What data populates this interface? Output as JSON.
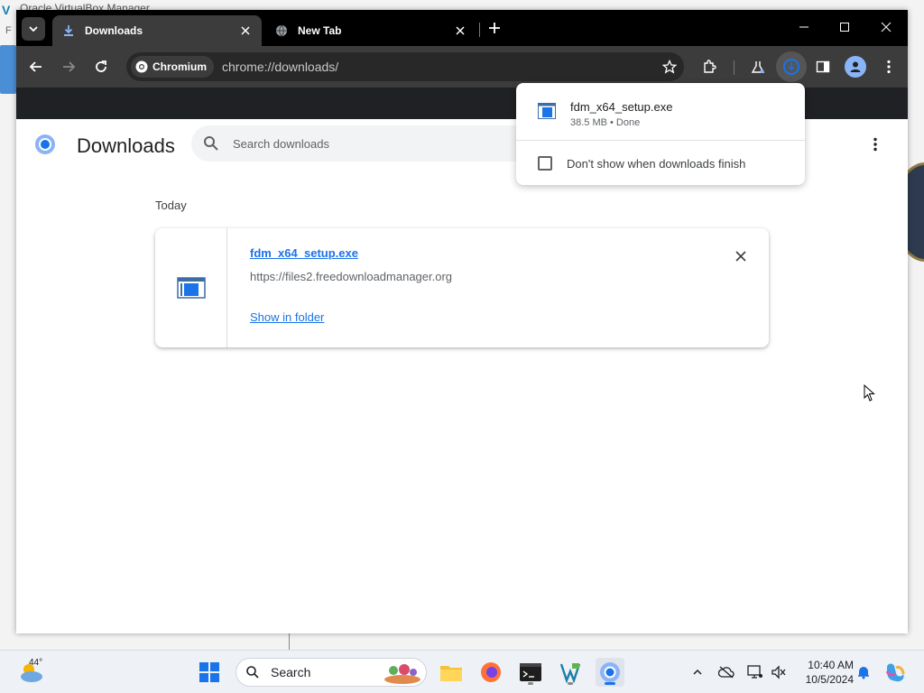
{
  "desktop": {
    "bg_app_title": "Oracle VirtualBox Manager",
    "bg_letter": "F"
  },
  "browser": {
    "tabs": [
      {
        "label": "Downloads",
        "active": true
      },
      {
        "label": "New Tab",
        "active": false
      }
    ],
    "toolbar": {
      "chip_label": "Chromium",
      "url": "chrome://downloads/"
    }
  },
  "downloads_page": {
    "title": "Downloads",
    "search_placeholder": "Search downloads",
    "section_label": "Today",
    "items": [
      {
        "file_name": "fdm_x64_setup.exe",
        "source_url": "https://files2.freedownloadmanager.org",
        "action_link": "Show in folder"
      }
    ]
  },
  "download_bubble": {
    "file_name": "fdm_x64_setup.exe",
    "status": "38.5 MB • Done",
    "checkbox_label": "Don't show when downloads finish",
    "checkbox_checked": false
  },
  "taskbar": {
    "weather_temp": "44°",
    "search_label": "Search",
    "time": "10:40 AM",
    "date": "10/5/2024"
  },
  "colors": {
    "accent": "#1a73e8",
    "tab_active_bg": "#3c3c3c",
    "tabstrip_bg": "#000000"
  }
}
